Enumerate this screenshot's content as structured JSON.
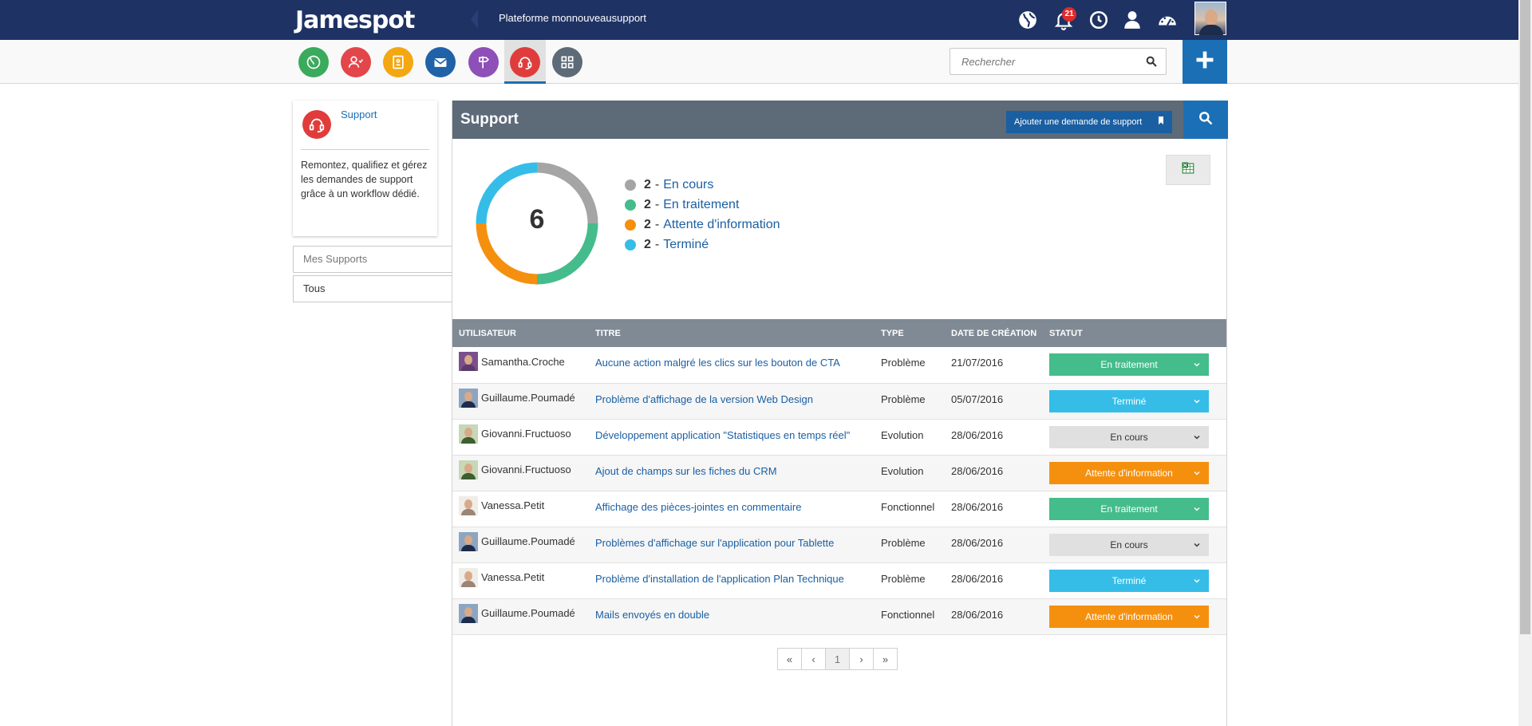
{
  "topbar": {
    "logo": "Jamespot",
    "platform": "Plateforme monnouveausupport",
    "notifications_count": "21",
    "icons": [
      "globe-icon",
      "bell-icon",
      "clock-icon",
      "user-icon",
      "dashboard-icon"
    ]
  },
  "appbar": {
    "apps": [
      {
        "name": "globe-app",
        "color": "#3aaa5c"
      },
      {
        "name": "contacts-app",
        "color": "#e2464a"
      },
      {
        "name": "directory-app",
        "color": "#f3a712"
      },
      {
        "name": "mail-app",
        "color": "#1f62a8"
      },
      {
        "name": "signpost-app",
        "color": "#8e4fb8"
      },
      {
        "name": "support-app",
        "color": "#e03c3c"
      },
      {
        "name": "more-apps",
        "color": "#5d6a78"
      }
    ],
    "search_placeholder": "Rechercher"
  },
  "sidebar": {
    "title": "Support",
    "description": "Remontez, qualifiez et gérez les demandes de support grâce à un workflow dédié.",
    "tabs": [
      "Mes Supports",
      "Tous"
    ]
  },
  "panel": {
    "title": "Support",
    "add_button": "Ajouter une demande de support"
  },
  "summary": {
    "total": "6",
    "items": [
      {
        "count": "2",
        "label": "En cours",
        "color": "#a5a5a5"
      },
      {
        "count": "2",
        "label": "En traitement",
        "color": "#45bc8b"
      },
      {
        "count": "2",
        "label": "Attente d'information",
        "color": "#f5900f"
      },
      {
        "count": "2",
        "label": "Terminé",
        "color": "#35bde7"
      }
    ]
  },
  "table": {
    "headers": [
      "UTILISATEUR",
      "TITRE",
      "TYPE",
      "DATE DE CRÉATION",
      "STATUT"
    ],
    "rows": [
      {
        "user": "Samantha.Croche",
        "title": "Aucune action malgré les clics sur les bouton de CTA",
        "type": "Problème",
        "date": "21/07/2016",
        "status": "En traitement",
        "status_color": "#45bc8b",
        "status_text_color": "#ffffff"
      },
      {
        "user": "Guillaume.Poumadé",
        "title": "Problème d'affichage de la version Web Design",
        "type": "Problème",
        "date": "05/07/2016",
        "status": "Terminé",
        "status_color": "#35bde7",
        "status_text_color": "#ffffff"
      },
      {
        "user": "Giovanni.Fructuoso",
        "title": "Développement application \"Statistiques en temps réel\"",
        "type": "Evolution",
        "date": "28/06/2016",
        "status": "En cours",
        "status_color": "#e0e0e0",
        "status_text_color": "#333333"
      },
      {
        "user": "Giovanni.Fructuoso",
        "title": "Ajout de champs sur les fiches du CRM",
        "type": "Evolution",
        "date": "28/06/2016",
        "status": "Attente d'information",
        "status_color": "#f5900f",
        "status_text_color": "#ffffff"
      },
      {
        "user": "Vanessa.Petit",
        "title": "Affichage des pièces-jointes en commentaire",
        "type": "Fonctionnel",
        "date": "28/06/2016",
        "status": "En traitement",
        "status_color": "#45bc8b",
        "status_text_color": "#ffffff"
      },
      {
        "user": "Guillaume.Poumadé",
        "title": "Problèmes d'affichage sur l'application pour Tablette",
        "type": "Problème",
        "date": "28/06/2016",
        "status": "En cours",
        "status_color": "#e0e0e0",
        "status_text_color": "#333333"
      },
      {
        "user": "Vanessa.Petit",
        "title": "Problème d'installation de l'application Plan Technique",
        "type": "Problème",
        "date": "28/06/2016",
        "status": "Terminé",
        "status_color": "#35bde7",
        "status_text_color": "#ffffff"
      },
      {
        "user": "Guillaume.Poumadé",
        "title": "Mails envoyés en double",
        "type": "Fonctionnel",
        "date": "28/06/2016",
        "status": "Attente d'information",
        "status_color": "#f5900f",
        "status_text_color": "#ffffff"
      }
    ]
  },
  "pagination": {
    "first": "«",
    "prev": "‹",
    "current": "1",
    "next": "›",
    "last": "»"
  }
}
